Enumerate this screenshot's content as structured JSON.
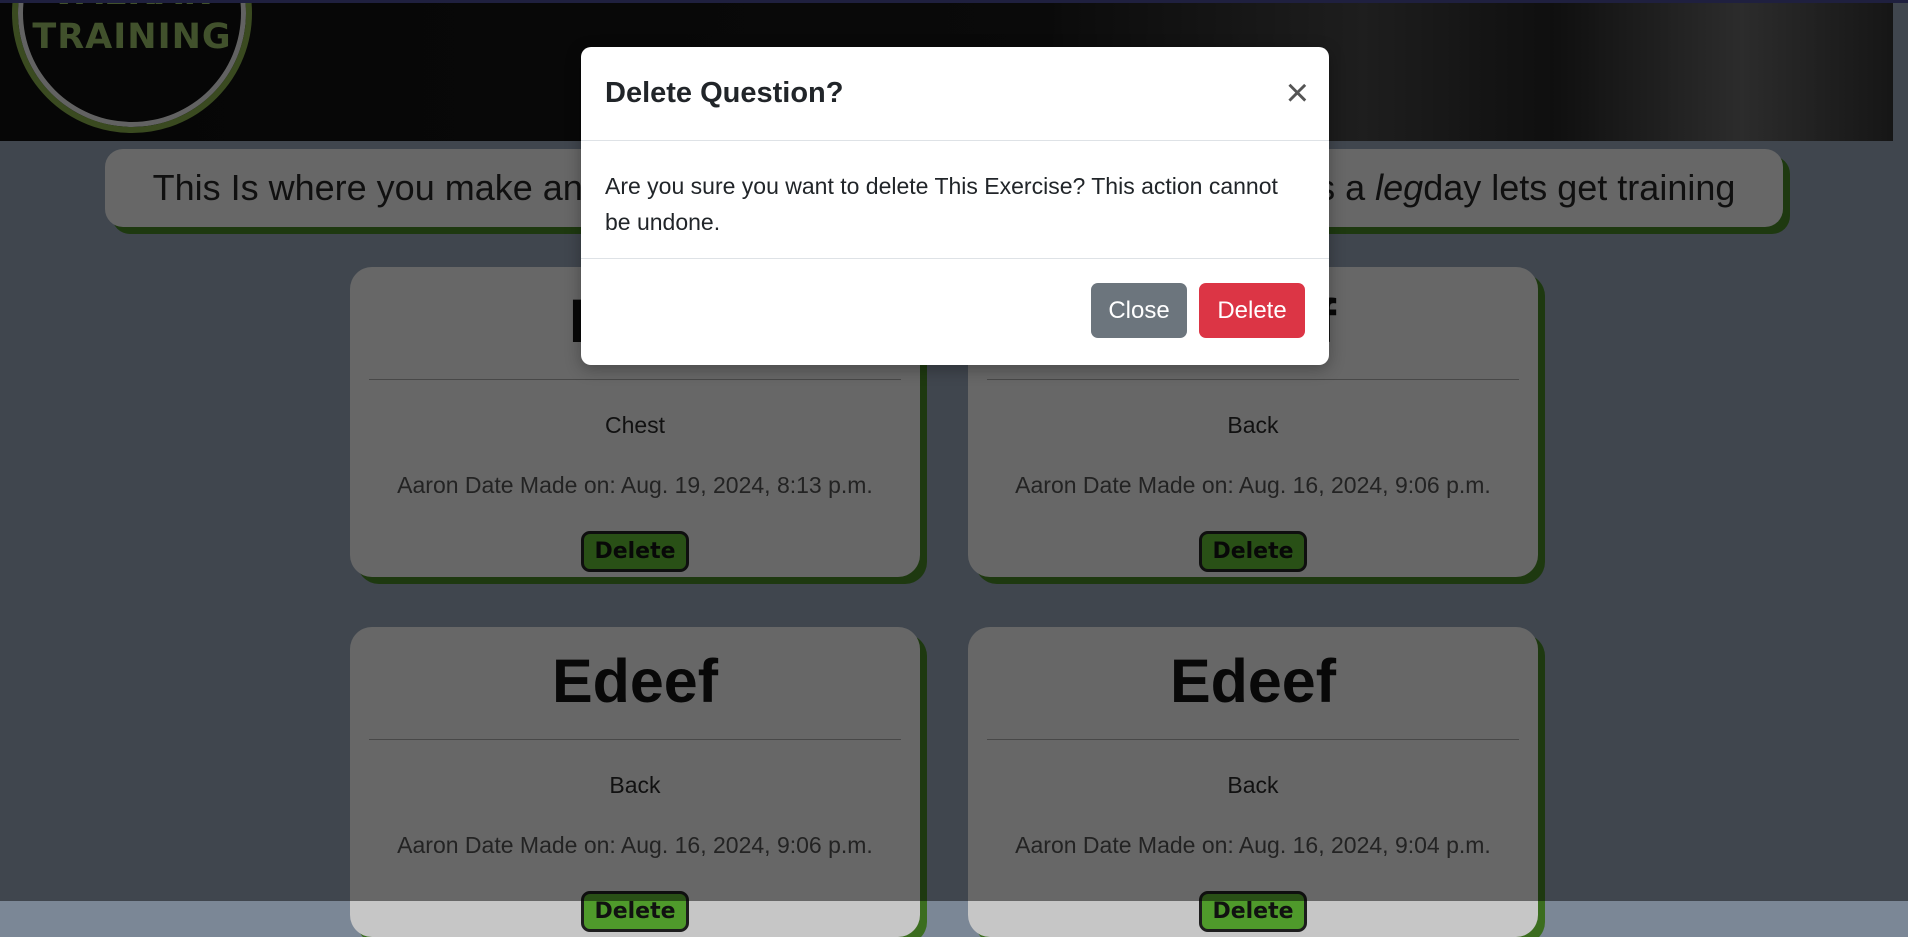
{
  "header": {
    "logo_line1": "VALKAN",
    "logo_line2": "TRAINING"
  },
  "banner": {
    "text_before": "This Is where you make and view your own exercises just incase you miss a",
    "emphasis": "leg",
    "text_after": " day lets get training"
  },
  "cards": [
    {
      "title": "First",
      "muscle": "Chest",
      "meta": "Aaron Date Made on: Aug. 19, 2024, 8:13 p.m.",
      "delete_label": "Delete"
    },
    {
      "title": "Edeef",
      "muscle": "Back",
      "meta": "Aaron Date Made on: Aug. 16, 2024, 9:06 p.m.",
      "delete_label": "Delete"
    },
    {
      "title": "Edeef",
      "muscle": "Back",
      "meta": "Aaron Date Made on: Aug. 16, 2024, 9:06 p.m.",
      "delete_label": "Delete"
    },
    {
      "title": "Edeef",
      "muscle": "Back",
      "meta": "Aaron Date Made on: Aug. 16, 2024, 9:04 p.m.",
      "delete_label": "Delete"
    }
  ],
  "modal": {
    "title": "Delete Question?",
    "close_icon": "×",
    "body": "Are you sure you want to delete This Exercise? This action cannot be undone.",
    "close_label": "Close",
    "delete_label": "Delete"
  },
  "colors": {
    "accent_green": "#4f9a2b",
    "danger": "#dc3545",
    "secondary": "#6c757d"
  }
}
